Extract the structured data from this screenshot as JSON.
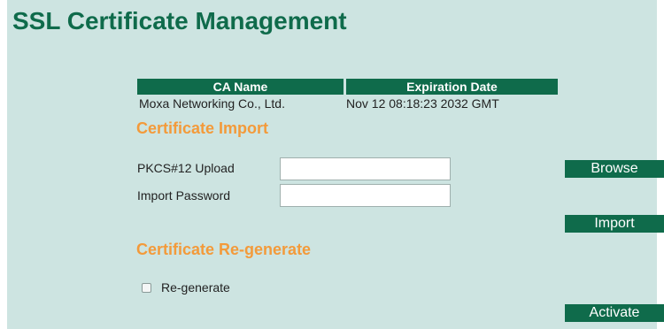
{
  "page": {
    "title": "SSL Certificate Management"
  },
  "ca_table": {
    "columns": [
      "CA Name",
      "Expiration Date"
    ],
    "rows": [
      [
        "Moxa Networking Co., Ltd.",
        "Nov 12 08:18:23 2032 GMT"
      ]
    ]
  },
  "import_section": {
    "title": "Certificate Import",
    "pkcs_label": "PKCS#12 Upload",
    "pkcs_value": "",
    "password_label": "Import Password",
    "password_value": "",
    "browse_button": "Browse",
    "import_button": "Import"
  },
  "regenerate_section": {
    "title": "Certificate Re-generate",
    "checkbox_label": "Re-generate",
    "checked": false,
    "activate_button": "Activate"
  },
  "colors": {
    "background": "#cde4e1",
    "primary_green": "#0f6b4b",
    "section_orange": "#f39a3a"
  }
}
